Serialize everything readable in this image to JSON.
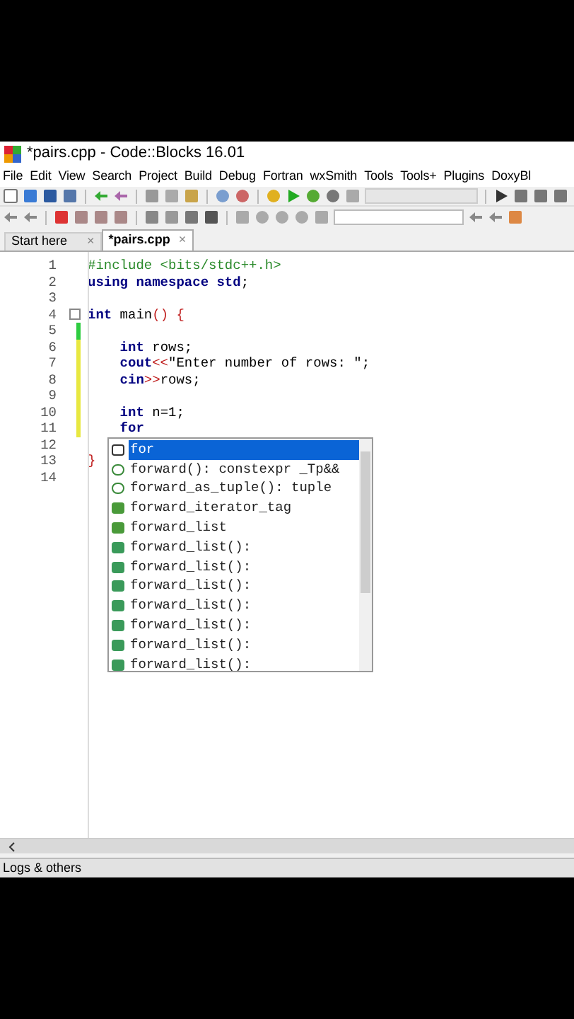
{
  "window": {
    "title": "*pairs.cpp - Code::Blocks 16.01"
  },
  "menu": [
    "File",
    "Edit",
    "View",
    "Search",
    "Project",
    "Build",
    "Debug",
    "Fortran",
    "wxSmith",
    "Tools",
    "Tools+",
    "Plugins",
    "DoxyBl"
  ],
  "tabs": [
    {
      "label": "Start here",
      "close": "×",
      "selected": false
    },
    {
      "label": "*pairs.cpp",
      "close": "×",
      "selected": true
    }
  ],
  "editor": {
    "lines": [
      {
        "number": "1",
        "tokens": [
          {
            "kind": "preproc",
            "text": "#include <bits/stdc++.h>"
          }
        ]
      },
      {
        "number": "2",
        "tokens": [
          {
            "kind": "keyword",
            "text": "using namespace std"
          },
          {
            "kind": "plain",
            "text": ";"
          }
        ]
      },
      {
        "number": "3"
      },
      {
        "number": "4",
        "fold": true,
        "tokens": [
          {
            "kind": "keyword",
            "text": "int"
          },
          {
            "kind": "plain",
            "text": " main"
          },
          {
            "kind": "op",
            "text": "() {"
          }
        ]
      },
      {
        "number": "5",
        "color": "#2ecc40"
      },
      {
        "number": "6",
        "color": "#e8e840",
        "tokens": [
          {
            "kind": "keyword",
            "text": "    int"
          },
          {
            "kind": "plain",
            "text": " rows;"
          }
        ]
      },
      {
        "number": "7",
        "color": "#e8e840",
        "tokens": [
          {
            "kind": "keyword",
            "text": "    cout"
          },
          {
            "kind": "op",
            "text": "<<"
          },
          {
            "kind": "plain",
            "text": "\"Enter number of rows: \";"
          }
        ]
      },
      {
        "number": "8",
        "color": "#e8e840",
        "tokens": [
          {
            "kind": "keyword",
            "text": "    cin"
          },
          {
            "kind": "op",
            "text": ">>"
          },
          {
            "kind": "plain",
            "text": "rows;"
          }
        ]
      },
      {
        "number": "9",
        "color": "#e8e840"
      },
      {
        "number": "10",
        "color": "#e8e840",
        "tokens": [
          {
            "kind": "keyword",
            "text": "    int"
          },
          {
            "kind": "plain",
            "text": " n=1;"
          }
        ]
      },
      {
        "number": "11",
        "color": "#e8e840",
        "tokens": [
          {
            "kind": "keyword",
            "text": "    for"
          }
        ]
      },
      {
        "number": "12"
      },
      {
        "number": "13",
        "tokens": [
          {
            "kind": "op",
            "text": "}"
          }
        ]
      },
      {
        "number": "14"
      }
    ]
  },
  "autocomplete": {
    "items": [
      {
        "kind": "keyword",
        "text": "for",
        "selected": true
      },
      {
        "kind": "function",
        "text": "forward(): constexpr _Tp&&",
        "selected": false
      },
      {
        "kind": "function",
        "text": "forward_as_tuple(): tuple",
        "selected": false
      },
      {
        "kind": "class",
        "text": "forward_iterator_tag",
        "selected": false
      },
      {
        "kind": "class",
        "text": "forward_list",
        "selected": false
      },
      {
        "kind": "constructor",
        "text": "forward_list():",
        "selected": false
      },
      {
        "kind": "constructor",
        "text": "forward_list():",
        "selected": false
      },
      {
        "kind": "constructor",
        "text": "forward_list():",
        "selected": false
      },
      {
        "kind": "constructor",
        "text": "forward_list():",
        "selected": false
      },
      {
        "kind": "constructor",
        "text": "forward_list():",
        "selected": false
      },
      {
        "kind": "constructor",
        "text": "forward_list():",
        "selected": false
      },
      {
        "kind": "constructor",
        "text": "forward_list():",
        "selected": false
      }
    ]
  },
  "logs_panel": {
    "title": "Logs & others"
  }
}
